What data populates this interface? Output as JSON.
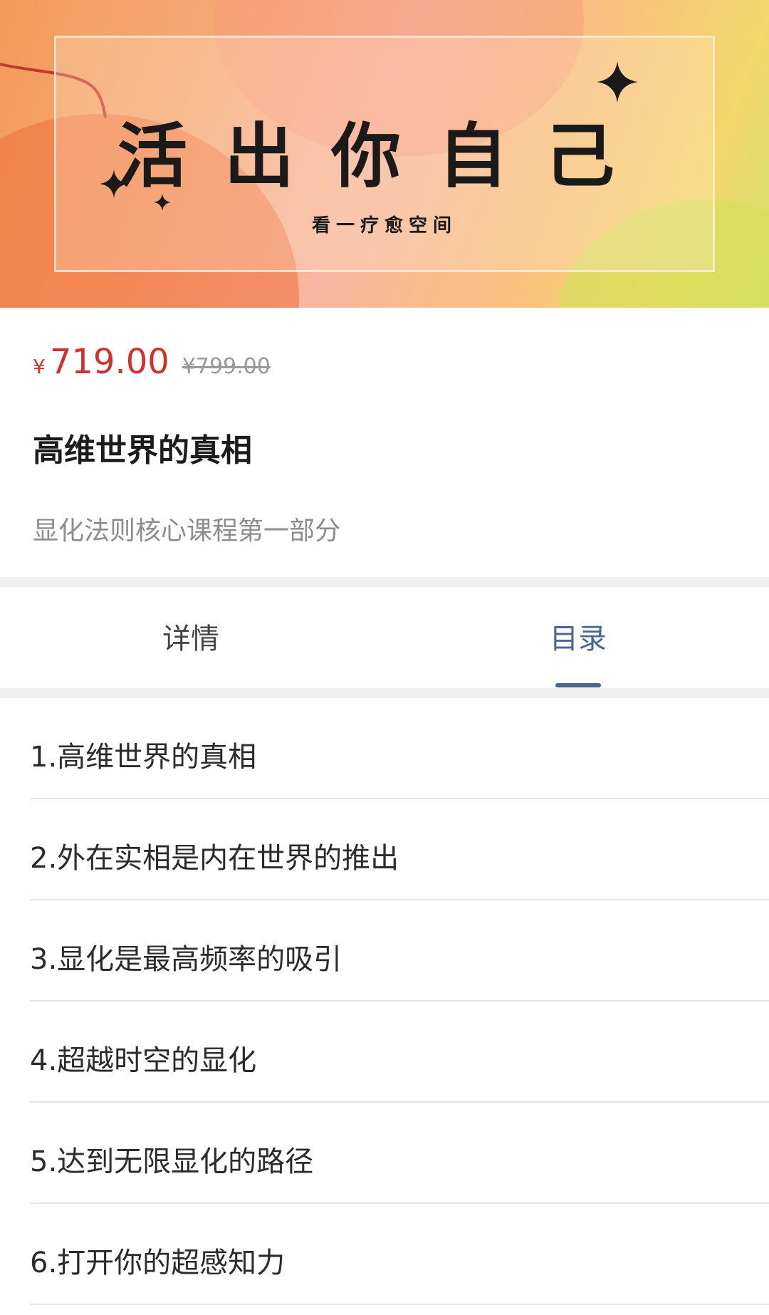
{
  "banner": {
    "title": "活出你自己",
    "subtitle": "看一疗愈空间"
  },
  "product": {
    "currency_symbol": "¥",
    "price": "719.00",
    "original_price": "¥799.00",
    "title": "高维世界的真相",
    "subtitle": "显化法则核心课程第一部分"
  },
  "tabs": [
    {
      "label": "详情",
      "active": false
    },
    {
      "label": "目录",
      "active": true
    }
  ],
  "catalog": [
    "1.高维世界的真相",
    "2.外在实相是内在世界的推出",
    "3.显化是最高频率的吸引",
    "4.超越时空的显化",
    "5.达到无限显化的路径",
    "6.打开你的超感知力"
  ],
  "colors": {
    "price": "#d0312d",
    "tab_active": "#4b6494",
    "divider": "#f0f0f0"
  }
}
